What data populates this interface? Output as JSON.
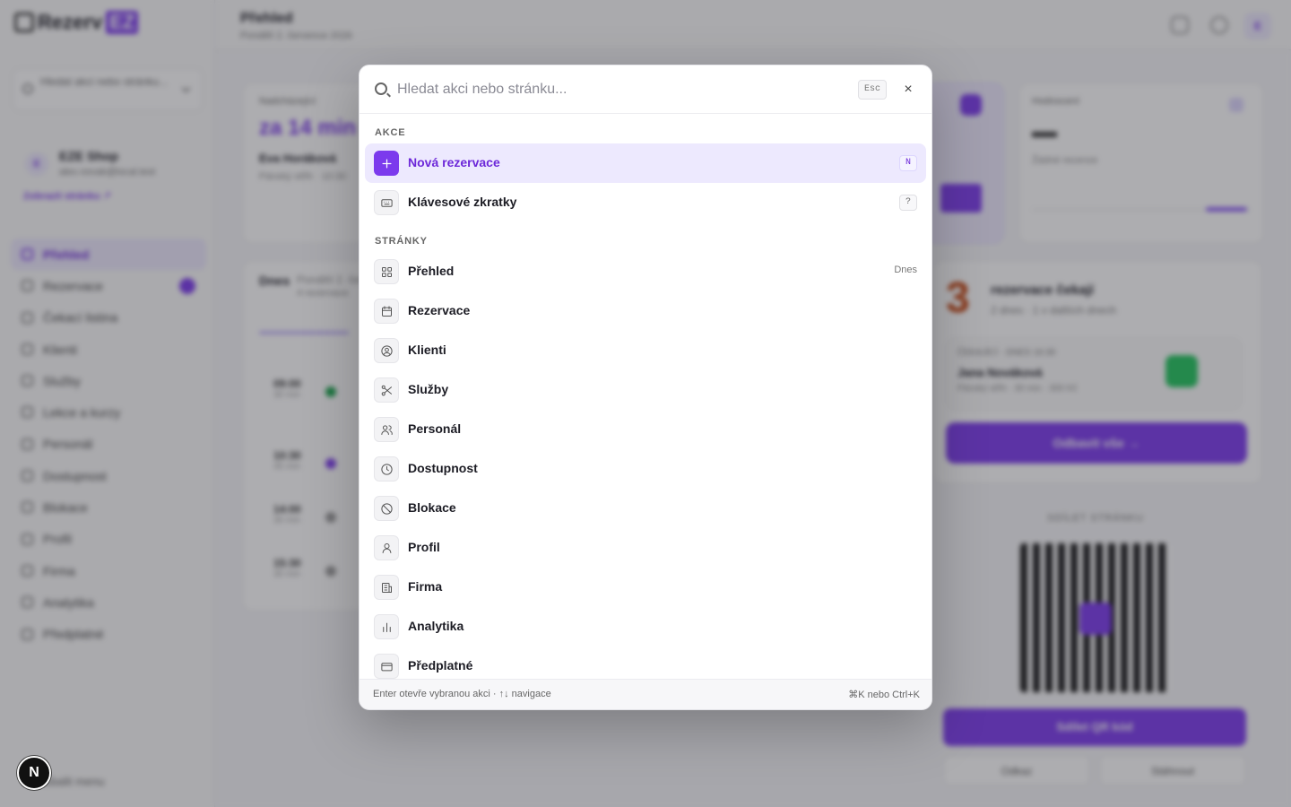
{
  "app": {
    "logo_text": "Rezerv",
    "logo_badge": "EZ",
    "sidebar_search": "Hledat akci nebo stránku...",
    "company_initial": "E",
    "company_name": "EZE Shop",
    "company_email": "alex.novak@local.test",
    "company_link": "Zobrazit stránku ↗",
    "nav": [
      {
        "label": "Přehled",
        "active": true
      },
      {
        "label": "Rezervace",
        "badge": true
      },
      {
        "label": "Čekací listina"
      },
      {
        "label": "Klienti"
      },
      {
        "label": "Služby"
      },
      {
        "label": "Lekce a kurzy"
      },
      {
        "label": "Personál"
      },
      {
        "label": "Dostupnost"
      },
      {
        "label": "Blokace"
      },
      {
        "label": "Profil"
      },
      {
        "label": "Firma"
      },
      {
        "label": "Analytika"
      },
      {
        "label": "Předplatné"
      }
    ],
    "collapse_label": "Sbalit menu",
    "dev_badge": "N",
    "page_title": "Přehled",
    "page_date": "Pondělí 2. července 2026",
    "avatar_initial": "E",
    "next_label": "Nadcházející",
    "next_value": "za 14 min",
    "next_client": "Eva Horáková",
    "next_detail": "Pánský střih · 10:30",
    "today_title": "Dnes",
    "today_date": "Pondělí 2. července",
    "today_count": "4 rezervace",
    "timeline": [
      {
        "time": "09:00",
        "dur": "30 min"
      },
      {
        "time": "10:30",
        "dur": "45 min"
      },
      {
        "time": "14:00",
        "dur": "30 min"
      },
      {
        "time": "15:30",
        "dur": "30 min"
      }
    ],
    "revenue_label": "Hodnocení",
    "revenue_sub": "Žádné recenze",
    "waiting_count": "3",
    "waiting_title": "rezervace čekají",
    "waiting_sub": "2 dnes · 1 v dalších dnech",
    "waiting_item_meta": "ČEKAJÍCÍ · DNES 16:30",
    "waiting_item_name": "Jana Nováková",
    "waiting_item_detail": "Pánský střih · 30 min · 300 Kč",
    "waiting_btn": "Odbavit vše →",
    "share_label": "SDÍLET STRÁNKU",
    "share_btn": "Sdílet QR kód",
    "share_copy": "Odkaz",
    "share_download": "Stáhnout"
  },
  "palette": {
    "placeholder": "Hledat akci nebo stránku...",
    "esc_label": "Esc",
    "close_icon": "×",
    "sections": {
      "actions": "AKCE",
      "pages": "STRÁNKY"
    },
    "actions": [
      {
        "label": "Nová rezervace",
        "icon": "plus-icon",
        "key": "N",
        "selected": true
      },
      {
        "label": "Klávesové zkratky",
        "icon": "keyboard-icon",
        "key": "?"
      }
    ],
    "pages": [
      {
        "label": "Přehled",
        "icon": "grid-icon",
        "hint": "Dnes"
      },
      {
        "label": "Rezervace",
        "icon": "calendar-icon"
      },
      {
        "label": "Klienti",
        "icon": "user-circle-icon"
      },
      {
        "label": "Služby",
        "icon": "scissors-icon"
      },
      {
        "label": "Personál",
        "icon": "users-icon"
      },
      {
        "label": "Dostupnost",
        "icon": "clock-icon"
      },
      {
        "label": "Blokace",
        "icon": "ban-icon"
      },
      {
        "label": "Profil",
        "icon": "user-icon"
      },
      {
        "label": "Firma",
        "icon": "building-icon"
      },
      {
        "label": "Analytika",
        "icon": "bar-chart-icon"
      },
      {
        "label": "Předplatné",
        "icon": "credit-card-icon"
      }
    ],
    "footer_left": "Enter otevře vybranou akci · ↑↓ navigace",
    "footer_right": "⌘K nebo Ctrl+K"
  },
  "colors": {
    "accent": "#7c3aed",
    "accent_soft": "#ede9fe",
    "overlay": "rgba(40,40,48,0.38)"
  }
}
